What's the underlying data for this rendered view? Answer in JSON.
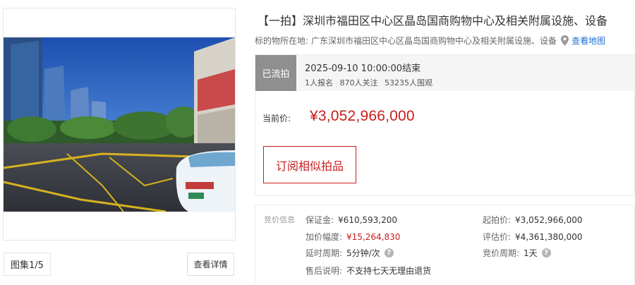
{
  "gallery": {
    "counter": "图集1/5",
    "details_label": "查看详情"
  },
  "item": {
    "title": "【一拍】深圳市福田区中心区晶岛国商购物中心及相关附属设施、设备",
    "location_label": "标的物所在地:",
    "location_value": "广东深圳市福田区中心区晶岛国商购物中心及相关附属设施、设备",
    "map_link": "查看地图"
  },
  "status": {
    "badge": "已流拍",
    "end_time": "2025-09-10 10:00:00结束",
    "signups": "1人报名",
    "followers": "870人关注",
    "viewers": "53235人围观",
    "price_label": "当前价:",
    "price_value": "¥3,052,966,000",
    "subscribe_label": "订阅相似拍品"
  },
  "bid_info": {
    "section_title": "竞价信息",
    "deposit_label": "保证金:",
    "deposit_value": "¥610,593,200",
    "starting_price_label": "起拍价:",
    "starting_price_value": "¥3,052,966,000",
    "increment_label": "加价幅度:",
    "increment_value": "¥15,264,830",
    "appraisal_label": "评估价:",
    "appraisal_value": "¥4,361,380,000",
    "extension_label": "延时周期:",
    "extension_value": "5分钟/次",
    "auction_period_label": "竞价周期:",
    "auction_period_value": "1天",
    "after_sales_label": "售后说明:",
    "after_sales_value": "不支持七天无理由退货"
  },
  "colors": {
    "accent_red": "#c81d1d",
    "link_blue": "#1f6fd1",
    "badge_gray": "#8f8f8f"
  },
  "icons": [
    "map-pin-icon",
    "help-icon"
  ]
}
